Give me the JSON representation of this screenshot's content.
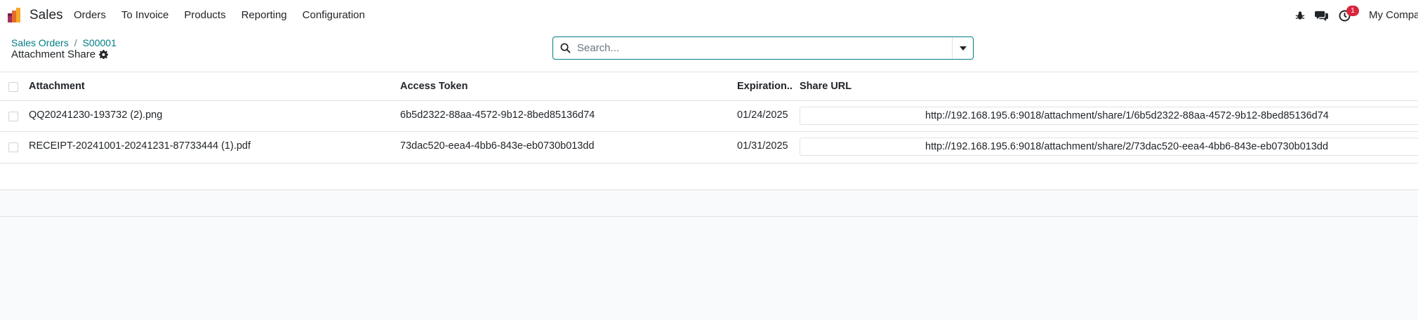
{
  "navbar": {
    "app_name": "Sales",
    "menu": [
      "Orders",
      "To Invoice",
      "Products",
      "Reporting",
      "Configuration"
    ],
    "activity_count": "1",
    "company": "My Compa"
  },
  "breadcrumb": {
    "parent": "Sales Orders",
    "current": "S00001",
    "separator": "/"
  },
  "page_title": "Attachment Share",
  "search": {
    "placeholder": "Search..."
  },
  "list": {
    "columns": {
      "attachment": "Attachment",
      "access_token": "Access Token",
      "expiration": "Expiration...",
      "share_url": "Share URL"
    },
    "rows": [
      {
        "attachment": "QQ20241230-193732 (2).png",
        "access_token": "6b5d2322-88aa-4572-9b12-8bed85136d74",
        "expiration": "01/24/2025",
        "share_url": "http://192.168.195.6:9018/attachment/share/1/6b5d2322-88aa-4572-9b12-8bed85136d74"
      },
      {
        "attachment": "RECEIPT-20241001-20241231-87733444 (1).pdf",
        "access_token": "73dac520-eea4-4bb6-843e-eb0730b013dd",
        "expiration": "01/31/2025",
        "share_url": "http://192.168.195.6:9018/attachment/share/2/73dac520-eea4-4bb6-843e-eb0730b013dd"
      }
    ]
  },
  "colors": {
    "accent": "#017e84",
    "badge": "#d9263d",
    "border": "#dee2e6",
    "muted_bg": "#f9fafb"
  }
}
